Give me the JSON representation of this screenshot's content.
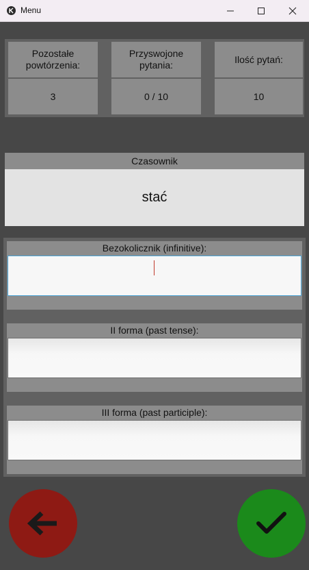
{
  "window": {
    "title": "Menu"
  },
  "stats": [
    {
      "label": "Pozostałe\npowtórzenia:",
      "value": "3"
    },
    {
      "label": "Przyswojone\npytania:",
      "value": "0 / 10"
    },
    {
      "label": "Ilość pytań:",
      "value": "10"
    }
  ],
  "verb": {
    "label": "Czasownik",
    "word": "stać"
  },
  "forms": [
    {
      "label": "Bezokolicznik (infinitive):",
      "value": ""
    },
    {
      "label": "II forma (past tense):",
      "value": ""
    },
    {
      "label": "III forma (past participle):",
      "value": ""
    }
  ],
  "colors": {
    "back": "#8e1a14",
    "confirm": "#1b8a1b"
  },
  "icons": {
    "back": "arrow-left-icon",
    "confirm": "checkmark-icon"
  }
}
